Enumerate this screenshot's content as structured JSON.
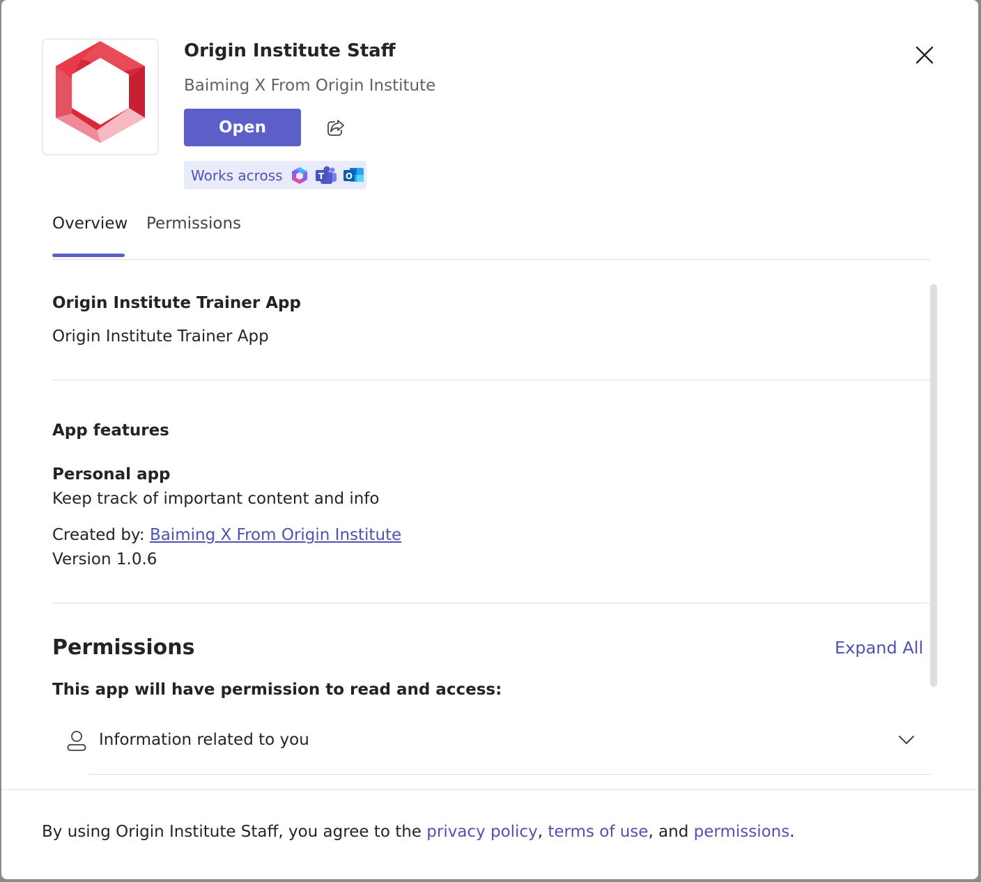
{
  "app": {
    "title": "Origin Institute Staff",
    "publisher": "Baiming X From Origin Institute",
    "open_label": "Open",
    "works_across_label": "Works across",
    "logo_colors": [
      "#d8283a",
      "#f08a98"
    ],
    "accent": "#5b5fc7"
  },
  "icons": {
    "close": "close-icon",
    "share": "share-icon",
    "m365": "microsoft-365-icon",
    "teams": "teams-icon",
    "outlook": "outlook-icon",
    "person": "person-icon",
    "chevron": "chevron-down-icon"
  },
  "tabs": [
    {
      "label": "Overview",
      "selected": true
    },
    {
      "label": "Permissions",
      "selected": false
    }
  ],
  "overview": {
    "heading": "Origin Institute Trainer App",
    "description": "Origin Institute Trainer App"
  },
  "features": {
    "heading": "App features",
    "feature_name": "Personal app",
    "feature_desc": "Keep track of important content and info",
    "created_by_label": "Created by:",
    "created_by_link": "Baiming X From Origin Institute",
    "version": "Version 1.0.6"
  },
  "permissions": {
    "heading": "Permissions",
    "expand_all": "Expand All",
    "intro": "This app will have permission to read and access:",
    "items": [
      {
        "label": "Information related to you"
      }
    ]
  },
  "footer": {
    "prefix": "By using Origin Institute Staff, you agree to the",
    "privacy": "privacy policy",
    "sep1": ",",
    "terms": "terms of use",
    "sep2": ", and",
    "permissions": "permissions",
    "end": "."
  }
}
